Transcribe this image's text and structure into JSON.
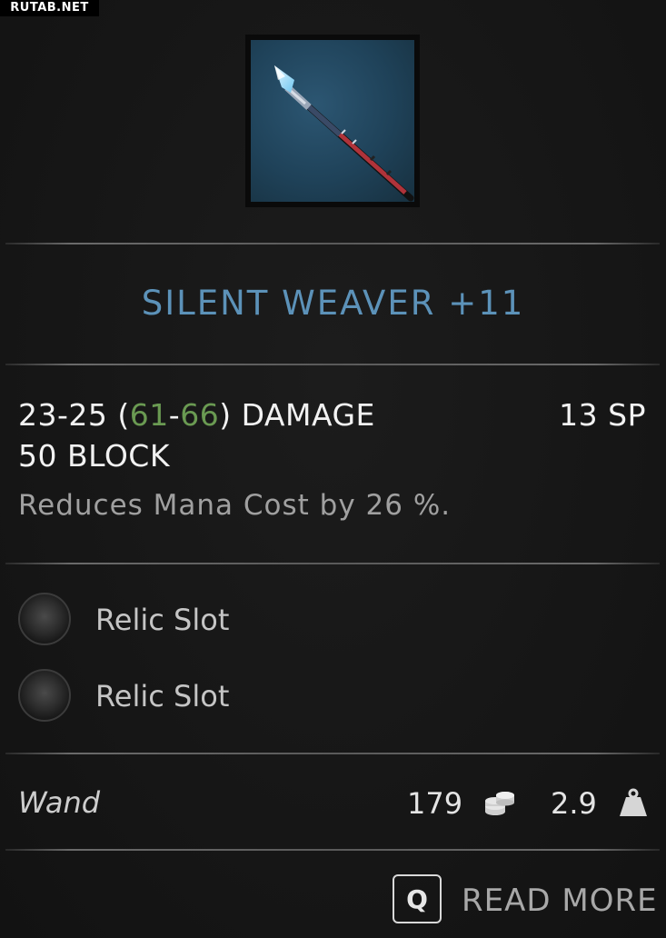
{
  "watermark": "RUTAB.NET",
  "item": {
    "name": "SILENT WEAVER +11",
    "icon": "spear-wand-icon",
    "damage": {
      "base_min": "23",
      "base_sep": "-",
      "base_max": "25",
      "open": " (",
      "scaled_min": "61",
      "scaled_sep": "-",
      "scaled_max": "66",
      "close": ")",
      "label": " DAMAGE"
    },
    "sp_cost": "13 SP",
    "block": "50 BLOCK",
    "effect": "Reduces Mana Cost by 26 %.",
    "slots": [
      {
        "label": "Relic Slot"
      },
      {
        "label": "Relic Slot"
      }
    ],
    "type": "Wand",
    "value": "179",
    "value_icon": "coins-icon",
    "weight": "2.9",
    "weight_icon": "weight-icon"
  },
  "actions": {
    "read_more_key": "Q",
    "read_more_label": "READ MORE"
  },
  "colors": {
    "title": "#5c92b9",
    "scaled_damage": "#6a9a52"
  }
}
